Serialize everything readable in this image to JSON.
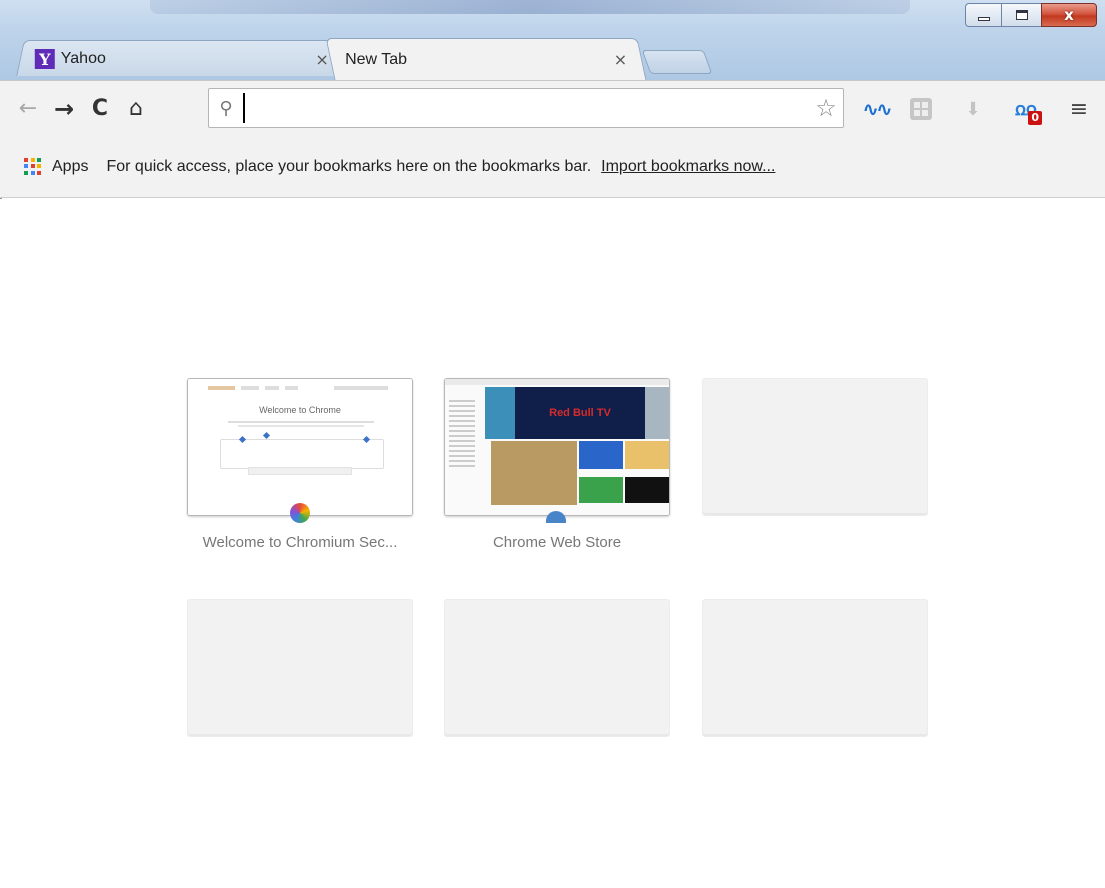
{
  "window": {
    "minimize_icon": "minimize-icon",
    "maximize_icon": "maximize-icon",
    "close_label": "x"
  },
  "tabs": [
    {
      "title": "Yahoo",
      "favicon": "yahoo-favicon",
      "favicon_letter": "Y",
      "close": "×",
      "active": false
    },
    {
      "title": "New Tab",
      "close": "×",
      "active": true
    }
  ],
  "toolbar": {
    "back_glyph": "←",
    "forward_glyph": "→",
    "reload_glyph": "C",
    "home_glyph": "⌂",
    "search_glyph": "⚲",
    "omnibox_value": "",
    "bookmark_star": "☆",
    "extensions": [
      {
        "icon": "wave-extension-icon",
        "glyph": "∿∿"
      },
      {
        "icon": "puzzle-extension-icon"
      },
      {
        "icon": "download-extension-icon",
        "glyph": "⬇"
      },
      {
        "icon": "monitor-extension-icon",
        "glyph": "ꭥꭥ",
        "badge": "0"
      }
    ],
    "menu_glyph": "≡"
  },
  "bookmarks_bar": {
    "apps_label": "Apps",
    "apps_dot_colors": [
      "#e0412f",
      "#f4b400",
      "#0f9d58",
      "#4285f4",
      "#e0412f",
      "#f4b400",
      "#0f9d58",
      "#4285f4",
      "#e0412f"
    ],
    "message": "For quick access, place your bookmarks here on the bookmarks bar.",
    "import_link": "Import bookmarks now..."
  },
  "most_visited": [
    {
      "caption": "Welcome to Chromium Sec...",
      "thumbnail_title": "Welcome to Chrome",
      "favicon_color": "#7b4fc4"
    },
    {
      "caption": "Chrome Web Store",
      "thumbnail_banner": "Red Bull TV",
      "favicon_color": "#4a84c8"
    },
    {
      "caption": ""
    },
    {
      "caption": ""
    },
    {
      "caption": ""
    },
    {
      "caption": ""
    }
  ],
  "colors": {
    "tabstrip": "#bdd3ea",
    "toolbar": "#f2f2f2",
    "empty_tile": "#f2f2f2",
    "caption_text": "#777777"
  }
}
